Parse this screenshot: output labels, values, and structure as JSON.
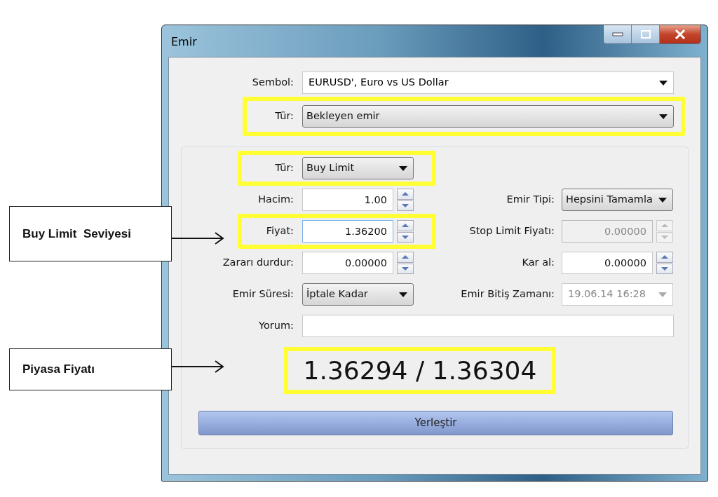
{
  "window": {
    "title": "Emir"
  },
  "top_fields": [
    {
      "kind": "combo",
      "label": "Sembol:",
      "value": "EURUSD', Euro vs US Dollar"
    },
    {
      "kind": "select",
      "label": "Tür:",
      "value": "Bekleyen emir",
      "highlighted": true
    }
  ],
  "order_form": {
    "rows": [
      {
        "left": {
          "kind": "select",
          "label": "Tür:",
          "value": "Buy Limit",
          "highlighted": true,
          "disabled": false
        }
      },
      {
        "left": {
          "kind": "spin",
          "label": "Hacim:",
          "value": "1.00",
          "disabled": false
        },
        "right": {
          "kind": "select",
          "label": "Emir Tipi:",
          "value": "Hepsini Tamamla",
          "disabled": false
        }
      },
      {
        "left": {
          "kind": "spin",
          "label": "Fiyat:",
          "value": "1.36200",
          "highlighted": true,
          "disabled": false,
          "focused": true
        },
        "right": {
          "kind": "spin",
          "label": "Stop Limit Fiyatı:",
          "value": "0.00000",
          "disabled": true
        }
      },
      {
        "left": {
          "kind": "spin",
          "label": "Zararı durdur:",
          "value": "0.00000",
          "disabled": false
        },
        "right": {
          "kind": "spin",
          "label": "Kar al:",
          "value": "0.00000",
          "disabled": false
        }
      },
      {
        "left": {
          "kind": "select",
          "label": "Emir Süresi:",
          "value": "İptale Kadar",
          "disabled": false
        },
        "right": {
          "kind": "combo",
          "label": "Emir Bitiş Zamanı:",
          "value": "19.06.14 16:28",
          "disabled": true
        }
      }
    ],
    "comment": {
      "label": "Yorum:"
    },
    "market_price": {
      "text": "1.36294 / 1.36304",
      "highlighted": true
    },
    "submit_button": "Yerleştir"
  },
  "callouts": [
    {
      "text": "Buy Limit  Seviyesi"
    },
    {
      "text": "Piyasa Fiyatı"
    }
  ]
}
